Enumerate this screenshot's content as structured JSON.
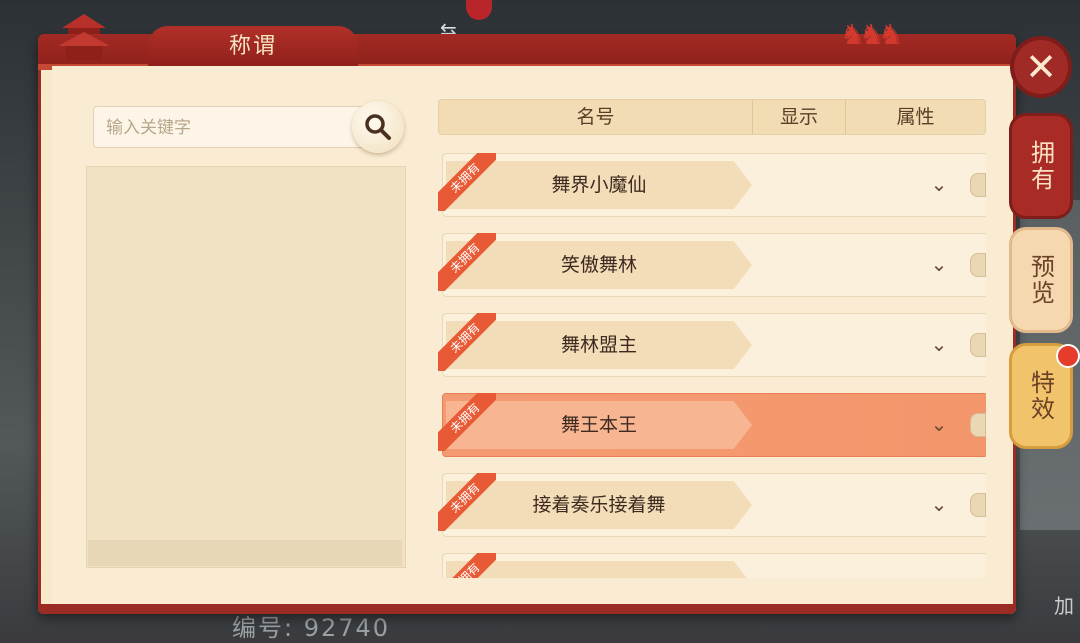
{
  "window": {
    "title": "称谓"
  },
  "search": {
    "placeholder": "输入关键字"
  },
  "table": {
    "headers": {
      "name": "名号",
      "show": "显示",
      "attr": "属性"
    },
    "rows": [
      {
        "name": "舞界小魔仙",
        "badge": "未拥有",
        "selected": false
      },
      {
        "name": "笑傲舞林",
        "badge": "未拥有",
        "selected": false
      },
      {
        "name": "舞林盟主",
        "badge": "未拥有",
        "selected": false
      },
      {
        "name": "舞王本王",
        "badge": "未拥有",
        "selected": true
      },
      {
        "name": "接着奏乐接着舞",
        "badge": "未拥有",
        "selected": false
      },
      {
        "name": "",
        "badge": "未拥有",
        "selected": false
      }
    ]
  },
  "side_tabs": [
    {
      "label": "拥有",
      "active": true
    },
    {
      "label": "预览",
      "active": false
    },
    {
      "label": "特效",
      "active": false,
      "has_notification": true
    }
  ],
  "background": {
    "bottom_text": "编号: 92740",
    "right_text": "加"
  },
  "icons": {
    "close": "close-icon",
    "search": "search-icon",
    "chevron": "chevron-down-icon"
  },
  "colors": {
    "accent_red": "#a32a24",
    "panel_bg": "#f8e9cc",
    "selected_row": "#f49a72",
    "ribbon": "#e85a35"
  }
}
